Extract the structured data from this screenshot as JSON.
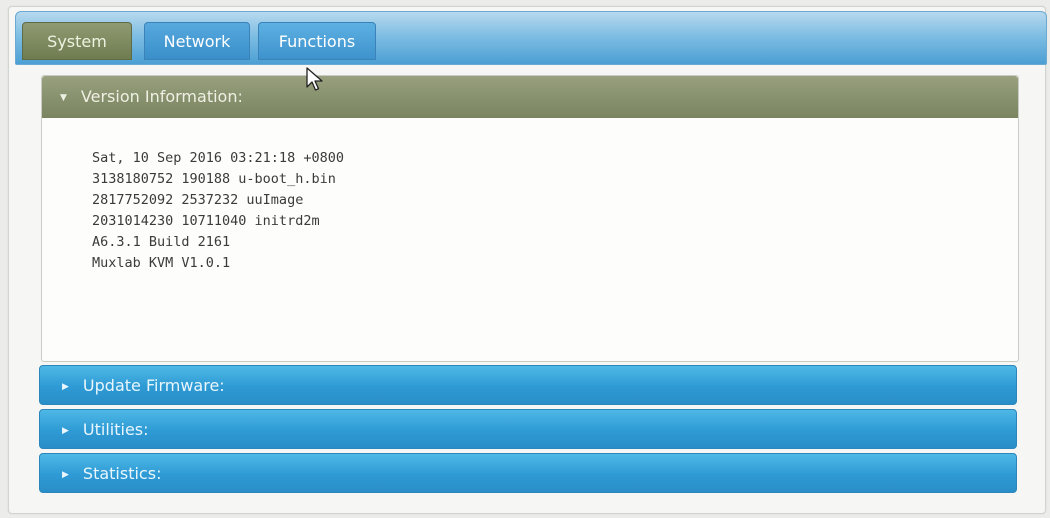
{
  "tabs": [
    {
      "label": "System"
    },
    {
      "label": "Network"
    },
    {
      "label": "Functions"
    }
  ],
  "version_panel": {
    "title": "Version Information:",
    "lines": [
      "Sat, 10 Sep 2016 03:21:18 +0800",
      "3138180752 190188 u-boot_h.bin",
      "2817752092 2537232 uuImage",
      "2031014230 10711040 initrd2m",
      "A6.3.1 Build 2161",
      "Muxlab KVM V1.0.1"
    ]
  },
  "sections": [
    {
      "label": "Update Firmware:"
    },
    {
      "label": "Utilities:"
    },
    {
      "label": "Statistics:"
    }
  ],
  "colors": {
    "active_tab": "#6f7c50",
    "inactive_tab": "#3a8fca",
    "section_header": "#2e9ad4"
  }
}
